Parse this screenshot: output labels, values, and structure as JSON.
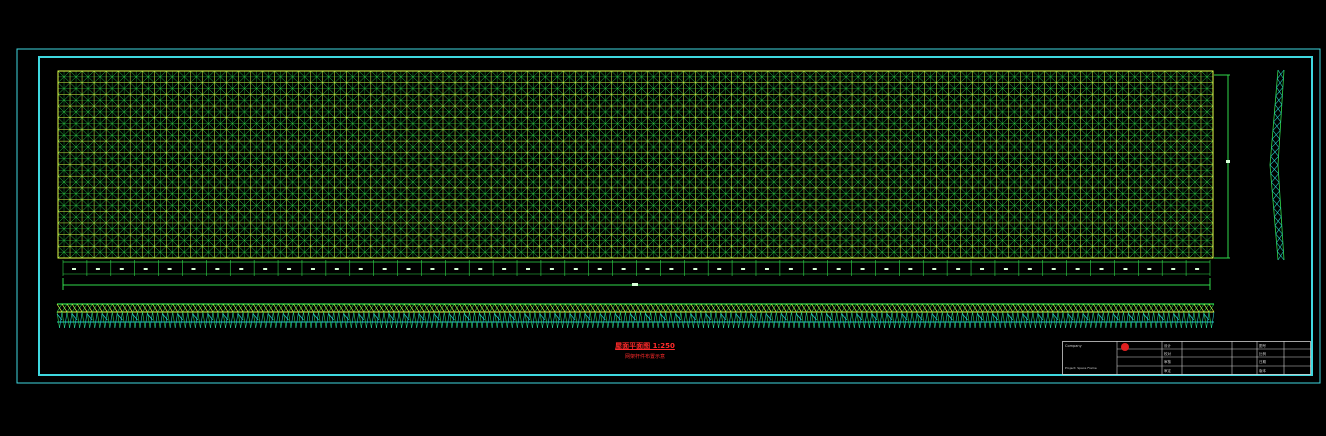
{
  "drawing": {
    "caption_main": "屋面平面图 1:250",
    "caption_sub": "网架杆件布置示意",
    "dimension_label": "—",
    "colors": {
      "background": "#000000",
      "frame": "#3fd9e0",
      "grid_upper": "#e4ff4a",
      "grid_lower": "#2fd84a",
      "diagonal": "#26c7c2",
      "caption": "#ff2a2a",
      "dimension": "#2fd84a"
    },
    "grid_columns": 96,
    "grid_rows": 16,
    "axis_markers": 48
  },
  "title_block": {
    "company": "Company",
    "project_line": "Project: Space Frame",
    "row_labels": [
      "设计",
      "校对",
      "审核",
      "审定"
    ],
    "cells": [
      "图号",
      "比例",
      "日期",
      "版本"
    ]
  }
}
